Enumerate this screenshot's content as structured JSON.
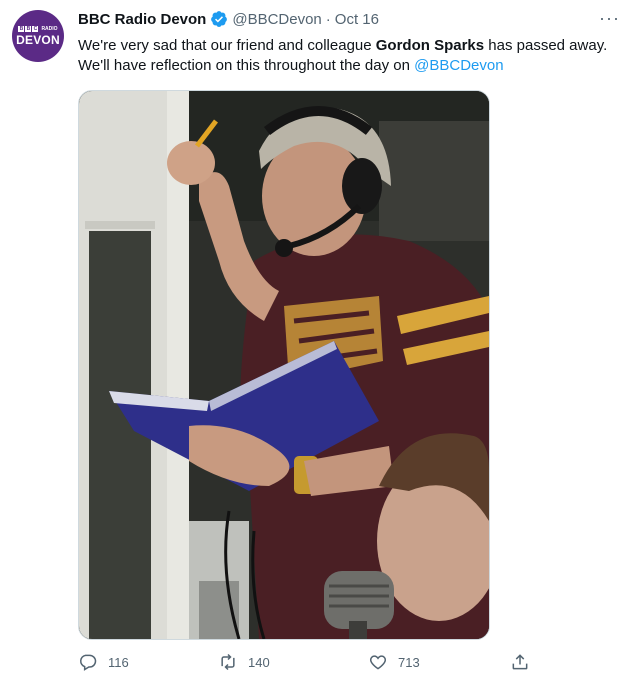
{
  "author": {
    "name": "BBC Radio Devon",
    "handle": "@BBCDevon",
    "separator": "·",
    "date": "Oct 16",
    "avatar": {
      "top_text": "BBC",
      "radio_text": "RADIO",
      "station": "DEVON",
      "bbc_letters": [
        "B",
        "B",
        "C"
      ]
    }
  },
  "tweet": {
    "text_part1": "We're very sad that our friend and colleague ",
    "bold_name": "Gordon Sparks",
    "text_part2": " has passed away. We'll have reflection on this throughout the day on ",
    "mention": "@BBCDevon"
  },
  "more_label": "···",
  "actions": {
    "replies": "116",
    "retweets": "140",
    "likes": "713"
  },
  "colors": {
    "accent": "#1d9bf0",
    "avatar_bg": "#5b2a86",
    "muted": "#536471"
  },
  "icons": [
    "verified-badge-icon",
    "more-icon",
    "reply-icon",
    "retweet-icon",
    "like-icon",
    "share-icon"
  ]
}
